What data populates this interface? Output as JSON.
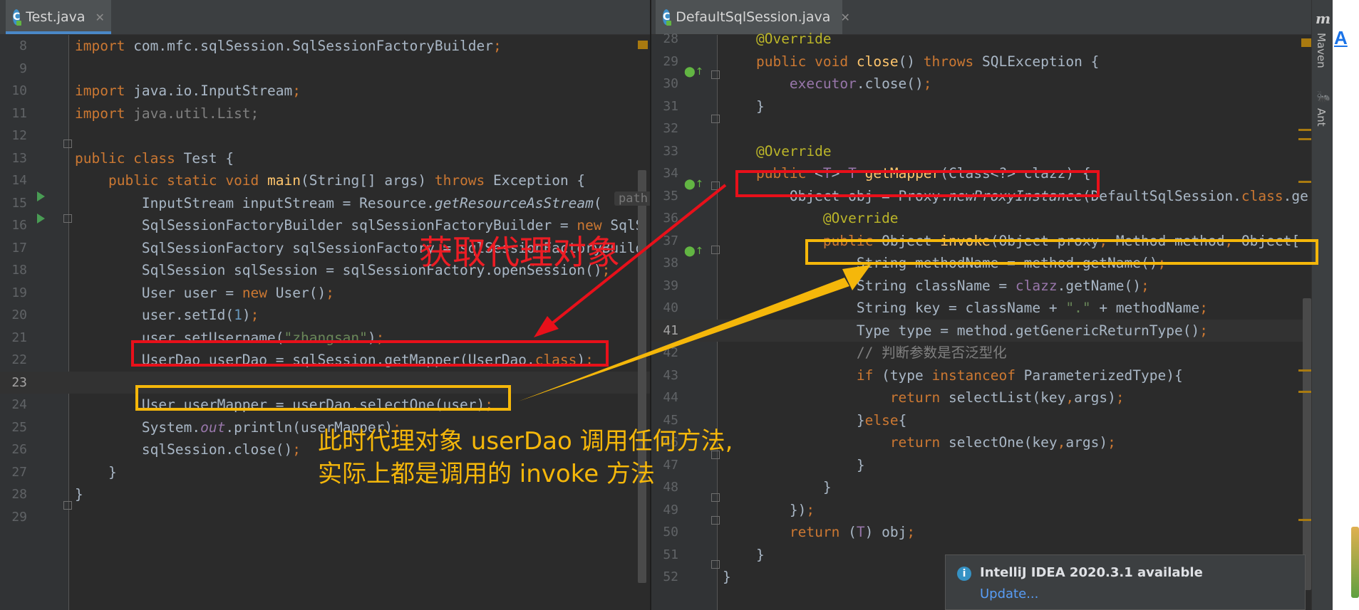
{
  "left_editor": {
    "tab": {
      "label": "Test.java",
      "icon_letter": "C",
      "close": "✕"
    },
    "inline_hint": "path:",
    "lines": [
      {
        "n": "8",
        "tokens": [
          [
            "kw",
            "import "
          ],
          [
            "",
            "com.mfc.sqlSession.SqlSessionFactoryBuilder"
          ],
          [
            "punc",
            ";"
          ]
        ]
      },
      {
        "n": "9",
        "tokens": []
      },
      {
        "n": "10",
        "tokens": [
          [
            "kw",
            "import "
          ],
          [
            "",
            "java.io.InputStream"
          ],
          [
            "punc",
            ";"
          ]
        ]
      },
      {
        "n": "11",
        "tokens": [
          [
            "kw",
            "import "
          ],
          [
            "cmt",
            "java.util.List;"
          ]
        ]
      },
      {
        "n": "12",
        "tokens": []
      },
      {
        "n": "13",
        "tokens": [
          [
            "kw",
            "public class "
          ],
          [
            "",
            "Test {"
          ]
        ]
      },
      {
        "n": "14",
        "tokens": [
          [
            "",
            "    "
          ],
          [
            "kw",
            "public static void "
          ],
          [
            "fn",
            "main"
          ],
          [
            "",
            "(String[] args) "
          ],
          [
            "kw",
            "throws "
          ],
          [
            "",
            "Exception {"
          ]
        ]
      },
      {
        "n": "15",
        "tokens": [
          [
            "",
            "        InputStream inputStream = Resource."
          ],
          [
            "it",
            "getResourceAsStream"
          ],
          [
            "",
            "( "
          ]
        ]
      },
      {
        "n": "16",
        "tokens": [
          [
            "",
            "        SqlSessionFactoryBuilder sqlSessionFactoryBuilder = "
          ],
          [
            "kw",
            "new "
          ],
          [
            "",
            "SqlS"
          ]
        ]
      },
      {
        "n": "17",
        "tokens": [
          [
            "",
            "        SqlSessionFactory sqlSessionFactory = sqlSessionFactoryBuild"
          ]
        ]
      },
      {
        "n": "18",
        "tokens": [
          [
            "",
            "        SqlSession sqlSession = sqlSessionFactory.openSession()"
          ],
          [
            "punc",
            ";"
          ]
        ]
      },
      {
        "n": "19",
        "tokens": [
          [
            "",
            "        User user = "
          ],
          [
            "kw",
            "new "
          ],
          [
            "",
            "User()"
          ],
          [
            "punc",
            ";"
          ]
        ]
      },
      {
        "n": "20",
        "tokens": [
          [
            "",
            "        user.setId("
          ],
          [
            "num",
            "1"
          ],
          [
            "",
            ")"
          ],
          [
            "punc",
            ";"
          ]
        ]
      },
      {
        "n": "21",
        "tokens": [
          [
            "",
            "        user.setUsername("
          ],
          [
            "str",
            "\"zhangsan\""
          ],
          [
            "",
            ")"
          ],
          [
            "punc",
            ";"
          ]
        ]
      },
      {
        "n": "22",
        "tokens": [
          [
            "",
            "        UserDao userDao = sqlSession.getMapper(UserDao."
          ],
          [
            "kw",
            "class"
          ],
          [
            "",
            ")"
          ],
          [
            "punc",
            ";"
          ]
        ]
      },
      {
        "n": "23",
        "tokens": []
      },
      {
        "n": "24",
        "tokens": [
          [
            "",
            "        User userMapper = userDao.selectOne(user)"
          ],
          [
            "punc",
            ";"
          ]
        ]
      },
      {
        "n": "25",
        "tokens": [
          [
            "",
            "        System."
          ],
          [
            "fld it",
            "out"
          ],
          [
            "",
            ".println(userMapper)"
          ],
          [
            "punc",
            ";"
          ]
        ]
      },
      {
        "n": "26",
        "tokens": [
          [
            "",
            "        sqlSession.close()"
          ],
          [
            "punc",
            ";"
          ]
        ]
      },
      {
        "n": "27",
        "tokens": [
          [
            "",
            "    }"
          ]
        ]
      },
      {
        "n": "28",
        "tokens": [
          [
            "",
            "}"
          ]
        ]
      },
      {
        "n": "29",
        "tokens": []
      }
    ]
  },
  "right_editor": {
    "tab": {
      "label": "DefaultSqlSession.java",
      "icon_letter": "C",
      "close": "✕"
    },
    "lines": [
      {
        "n": "28",
        "tokens": [
          [
            "",
            "    "
          ],
          [
            "ann",
            "@Override"
          ]
        ]
      },
      {
        "n": "29",
        "tokens": [
          [
            "",
            "    "
          ],
          [
            "kw",
            "public void "
          ],
          [
            "fn",
            "close"
          ],
          [
            "",
            "() "
          ],
          [
            "kw",
            "throws "
          ],
          [
            "",
            "SQLException {"
          ]
        ]
      },
      {
        "n": "30",
        "tokens": [
          [
            "",
            "        "
          ],
          [
            "fld",
            "executor"
          ],
          [
            "",
            ".close()"
          ],
          [
            "punc",
            ";"
          ]
        ]
      },
      {
        "n": "31",
        "tokens": [
          [
            "",
            "    }"
          ]
        ]
      },
      {
        "n": "32",
        "tokens": []
      },
      {
        "n": "33",
        "tokens": [
          [
            "",
            "    "
          ],
          [
            "ann",
            "@Override"
          ]
        ]
      },
      {
        "n": "34",
        "tokens": [
          [
            "",
            "    "
          ],
          [
            "kw",
            "public "
          ],
          [
            "",
            "<"
          ],
          [
            "fld",
            "T"
          ],
          [
            "",
            "> "
          ],
          [
            "fld",
            "T "
          ],
          [
            "fn",
            "getMapper"
          ],
          [
            "",
            "(Class<?> clazz) {"
          ]
        ]
      },
      {
        "n": "35",
        "tokens": [
          [
            "",
            "        Object obj = Proxy."
          ],
          [
            "it",
            "newProxyInstance"
          ],
          [
            "",
            "(DefaultSqlSession."
          ],
          [
            "kw",
            "class"
          ],
          [
            "",
            ".ge"
          ]
        ]
      },
      {
        "n": "36",
        "tokens": [
          [
            "",
            "            "
          ],
          [
            "ann",
            "@Override"
          ]
        ]
      },
      {
        "n": "37",
        "tokens": [
          [
            "",
            "            "
          ],
          [
            "kw",
            "public "
          ],
          [
            "",
            "Object "
          ],
          [
            "fn",
            "invoke"
          ],
          [
            "",
            "(Object proxy"
          ],
          [
            "punc",
            ", "
          ],
          [
            "",
            "Method method"
          ],
          [
            "punc",
            ", "
          ],
          [
            "",
            "Object["
          ]
        ]
      },
      {
        "n": "38",
        "tokens": [
          [
            "",
            "                String methodName = method.getName()"
          ],
          [
            "punc",
            ";"
          ]
        ]
      },
      {
        "n": "39",
        "tokens": [
          [
            "",
            "                String className = "
          ],
          [
            "fld",
            "clazz"
          ],
          [
            "",
            ".getName()"
          ],
          [
            "punc",
            ";"
          ]
        ]
      },
      {
        "n": "40",
        "tokens": [
          [
            "",
            "                String key = className + "
          ],
          [
            "str",
            "\".\""
          ],
          [
            "",
            " + methodName"
          ],
          [
            "punc",
            ";"
          ]
        ]
      },
      {
        "n": "41",
        "tokens": [
          [
            "",
            "                Type type = method.getGenericReturnType()"
          ],
          [
            "punc",
            ";"
          ]
        ]
      },
      {
        "n": "42",
        "tokens": [
          [
            "",
            "                "
          ],
          [
            "cmt",
            "// 判断参数是否泛型化"
          ]
        ]
      },
      {
        "n": "43",
        "tokens": [
          [
            "",
            "                "
          ],
          [
            "kw",
            "if "
          ],
          [
            "",
            "(type "
          ],
          [
            "kw",
            "instanceof "
          ],
          [
            "",
            "ParameterizedType){"
          ]
        ]
      },
      {
        "n": "44",
        "tokens": [
          [
            "",
            "                    "
          ],
          [
            "kw",
            "return "
          ],
          [
            "",
            "selectList(key"
          ],
          [
            "punc",
            ","
          ],
          [
            "",
            "args)"
          ],
          [
            "punc",
            ";"
          ]
        ]
      },
      {
        "n": "45",
        "tokens": [
          [
            "",
            "                }"
          ],
          [
            "kw",
            "else"
          ],
          [
            "",
            "{"
          ]
        ]
      },
      {
        "n": "46",
        "tokens": [
          [
            "",
            "                    "
          ],
          [
            "kw",
            "return "
          ],
          [
            "",
            "selectOne(key"
          ],
          [
            "punc",
            ","
          ],
          [
            "",
            "args)"
          ],
          [
            "punc",
            ";"
          ]
        ]
      },
      {
        "n": "47",
        "tokens": [
          [
            "",
            "                }"
          ]
        ]
      },
      {
        "n": "48",
        "tokens": [
          [
            "",
            "            }"
          ]
        ]
      },
      {
        "n": "49",
        "tokens": [
          [
            "",
            "        })"
          ],
          [
            "punc",
            ";"
          ]
        ]
      },
      {
        "n": "50",
        "tokens": [
          [
            "",
            "        "
          ],
          [
            "kw",
            "return "
          ],
          [
            "",
            "("
          ],
          [
            "fld",
            "T"
          ],
          [
            "",
            ") obj"
          ],
          [
            "punc",
            ";"
          ]
        ]
      },
      {
        "n": "51",
        "tokens": [
          [
            "",
            "    }"
          ]
        ]
      },
      {
        "n": "52",
        "tokens": [
          [
            "",
            "}"
          ]
        ]
      }
    ]
  },
  "annotations": {
    "proxy_label": "获取代理对象",
    "explain_line1": "此时代理对象 userDao 调用任何方法,",
    "explain_line2": "实际上都是调用的 invoke 方法"
  },
  "tool_strip": {
    "maven_label": "Maven",
    "ant_label": "Ant",
    "maven_glyph": "m",
    "ant_glyph": "🐜"
  },
  "outer_right_glyph": "A",
  "notification": {
    "title": "IntelliJ IDEA 2020.3.1 available",
    "link": "Update..."
  },
  "colors": {
    "red_box": "#e8101a",
    "orange_box": "#f5b70a",
    "keyword": "#cc7832",
    "function": "#ffc66d",
    "string": "#6a8759",
    "annotation": "#bbb529"
  }
}
